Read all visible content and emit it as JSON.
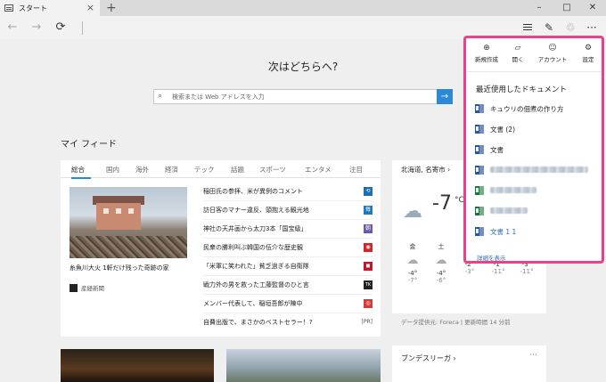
{
  "browser": {
    "tab_title": "スタート",
    "new_tab": "+",
    "tab_close": "×",
    "window_controls": {
      "minimize": "–",
      "maximize": "□",
      "close": "✕"
    },
    "nav": {
      "back": "←",
      "forward": "→",
      "refresh": "⟳"
    },
    "toolbar": {
      "note": "✎",
      "share": "♲",
      "more": "···"
    }
  },
  "page": {
    "heading": "次はどちらへ?",
    "search_placeholder": "検索または Web アドレスを入力",
    "search_go": "→",
    "my_feed": "マイ フィード"
  },
  "feed": {
    "categories": [
      "総合",
      "国内",
      "海外",
      "経済",
      "テック",
      "話題",
      "スポーツ",
      "エンタメ",
      "注目"
    ],
    "hero_caption": "糸魚川大火 1軒だけ残った奇跡の家",
    "hero_source": "産経新聞",
    "news": [
      {
        "title": "稲田氏の参拝、米が異例のコメント",
        "pub_color": "#1f6fb0",
        "pub_icon": "⟲"
      },
      {
        "title": "訪日客のマナー違反、頭抱える観光地",
        "pub_color": "#1e7ab8",
        "pub_icon": "毎"
      },
      {
        "title": "神社の天井画から太刀3本「国宝級」",
        "pub_color": "#6b5aa3",
        "pub_icon": "朝"
      },
      {
        "title": "民衆の勝利叫ぶ韓国の伍介な歴史観",
        "pub_color": "#d32525",
        "pub_icon": "◉"
      },
      {
        "title": "「米軍に笑われた」貧乏過ぎる自衛隊",
        "pub_color": "#c4162a",
        "pub_icon": "◼"
      },
      {
        "title": "戦力外の男を救った工藤監督のひと言",
        "pub_color": "#222222",
        "pub_icon": "TK"
      },
      {
        "title": "メンバー代表して、稲垣吾郎が陳中",
        "pub_color": "#d43a3a",
        "pub_icon": "◎"
      },
      {
        "title": "自費出版で、まさかのベストセラー！?",
        "pub_color": "#ffffff",
        "pub_icon": "[PR]"
      }
    ]
  },
  "weather": {
    "location": "北海道, 名寄市",
    "location_arrow": "›",
    "current_temp": "-7",
    "unit": "°C",
    "current_icon": "☁",
    "forecast": [
      {
        "day": "金",
        "icon": "☁",
        "high": "-4°",
        "low": "-7°"
      },
      {
        "day": "土",
        "icon": "☁",
        "high": "-4°",
        "low": "-6°"
      },
      {
        "day": "",
        "icon": "☁",
        "high": "-2°",
        "low": "-3°"
      },
      {
        "day": "",
        "icon": "☁",
        "high": "-1°",
        "low": "-11°"
      },
      {
        "day": "",
        "icon": "☁",
        "high": "-3°",
        "low": "-11°"
      }
    ],
    "provider": "データ提供元: Foreca | 更新時間 14 分前"
  },
  "bottom": {
    "card3_title": "ブンデスリーガ ›",
    "card3_more": "···"
  },
  "panel": {
    "buttons": [
      {
        "icon": "⊕",
        "label": "新規作成"
      },
      {
        "icon": "▱",
        "label": "開く"
      },
      {
        "icon": "☺",
        "label": "アカウント"
      },
      {
        "icon": "⚙",
        "label": "設定"
      }
    ],
    "title": "最近使用したドキュメント",
    "documents": [
      {
        "name": "キュウリの佃煮の作り方",
        "type": "word"
      },
      {
        "name": "文書 (2)",
        "type": "word"
      },
      {
        "name": "文書",
        "type": "word"
      },
      {
        "name": "",
        "type": "word"
      },
      {
        "name": "",
        "type": "excel"
      },
      {
        "name": "",
        "type": "excel"
      },
      {
        "name": "文書 1 1",
        "type": "word"
      }
    ],
    "more_link": "詳細を表示"
  }
}
